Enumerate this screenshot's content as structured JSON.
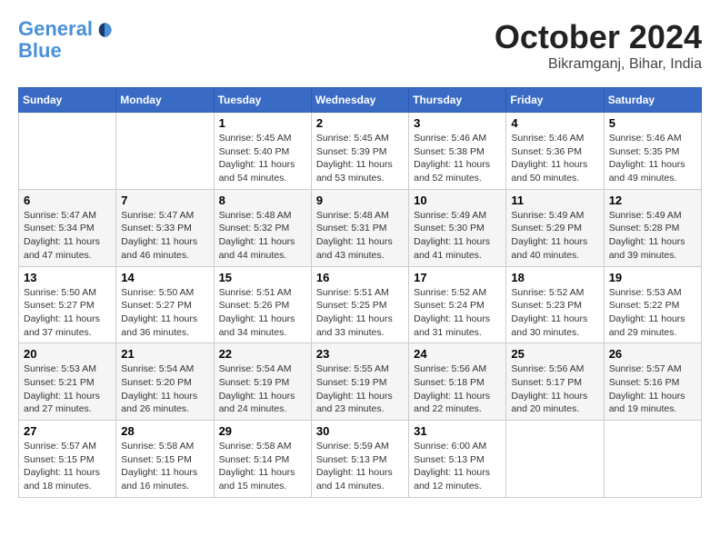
{
  "header": {
    "logo": {
      "line1": "General",
      "line2": "Blue"
    },
    "title": "October 2024",
    "location": "Bikramganj, Bihar, India"
  },
  "weekdays": [
    "Sunday",
    "Monday",
    "Tuesday",
    "Wednesday",
    "Thursday",
    "Friday",
    "Saturday"
  ],
  "weeks": [
    [
      {
        "day": null,
        "text": ""
      },
      {
        "day": null,
        "text": ""
      },
      {
        "day": "1",
        "text": "Sunrise: 5:45 AM\nSunset: 5:40 PM\nDaylight: 11 hours and 54 minutes."
      },
      {
        "day": "2",
        "text": "Sunrise: 5:45 AM\nSunset: 5:39 PM\nDaylight: 11 hours and 53 minutes."
      },
      {
        "day": "3",
        "text": "Sunrise: 5:46 AM\nSunset: 5:38 PM\nDaylight: 11 hours and 52 minutes."
      },
      {
        "day": "4",
        "text": "Sunrise: 5:46 AM\nSunset: 5:36 PM\nDaylight: 11 hours and 50 minutes."
      },
      {
        "day": "5",
        "text": "Sunrise: 5:46 AM\nSunset: 5:35 PM\nDaylight: 11 hours and 49 minutes."
      }
    ],
    [
      {
        "day": "6",
        "text": "Sunrise: 5:47 AM\nSunset: 5:34 PM\nDaylight: 11 hours and 47 minutes."
      },
      {
        "day": "7",
        "text": "Sunrise: 5:47 AM\nSunset: 5:33 PM\nDaylight: 11 hours and 46 minutes."
      },
      {
        "day": "8",
        "text": "Sunrise: 5:48 AM\nSunset: 5:32 PM\nDaylight: 11 hours and 44 minutes."
      },
      {
        "day": "9",
        "text": "Sunrise: 5:48 AM\nSunset: 5:31 PM\nDaylight: 11 hours and 43 minutes."
      },
      {
        "day": "10",
        "text": "Sunrise: 5:49 AM\nSunset: 5:30 PM\nDaylight: 11 hours and 41 minutes."
      },
      {
        "day": "11",
        "text": "Sunrise: 5:49 AM\nSunset: 5:29 PM\nDaylight: 11 hours and 40 minutes."
      },
      {
        "day": "12",
        "text": "Sunrise: 5:49 AM\nSunset: 5:28 PM\nDaylight: 11 hours and 39 minutes."
      }
    ],
    [
      {
        "day": "13",
        "text": "Sunrise: 5:50 AM\nSunset: 5:27 PM\nDaylight: 11 hours and 37 minutes."
      },
      {
        "day": "14",
        "text": "Sunrise: 5:50 AM\nSunset: 5:27 PM\nDaylight: 11 hours and 36 minutes."
      },
      {
        "day": "15",
        "text": "Sunrise: 5:51 AM\nSunset: 5:26 PM\nDaylight: 11 hours and 34 minutes."
      },
      {
        "day": "16",
        "text": "Sunrise: 5:51 AM\nSunset: 5:25 PM\nDaylight: 11 hours and 33 minutes."
      },
      {
        "day": "17",
        "text": "Sunrise: 5:52 AM\nSunset: 5:24 PM\nDaylight: 11 hours and 31 minutes."
      },
      {
        "day": "18",
        "text": "Sunrise: 5:52 AM\nSunset: 5:23 PM\nDaylight: 11 hours and 30 minutes."
      },
      {
        "day": "19",
        "text": "Sunrise: 5:53 AM\nSunset: 5:22 PM\nDaylight: 11 hours and 29 minutes."
      }
    ],
    [
      {
        "day": "20",
        "text": "Sunrise: 5:53 AM\nSunset: 5:21 PM\nDaylight: 11 hours and 27 minutes."
      },
      {
        "day": "21",
        "text": "Sunrise: 5:54 AM\nSunset: 5:20 PM\nDaylight: 11 hours and 26 minutes."
      },
      {
        "day": "22",
        "text": "Sunrise: 5:54 AM\nSunset: 5:19 PM\nDaylight: 11 hours and 24 minutes."
      },
      {
        "day": "23",
        "text": "Sunrise: 5:55 AM\nSunset: 5:19 PM\nDaylight: 11 hours and 23 minutes."
      },
      {
        "day": "24",
        "text": "Sunrise: 5:56 AM\nSunset: 5:18 PM\nDaylight: 11 hours and 22 minutes."
      },
      {
        "day": "25",
        "text": "Sunrise: 5:56 AM\nSunset: 5:17 PM\nDaylight: 11 hours and 20 minutes."
      },
      {
        "day": "26",
        "text": "Sunrise: 5:57 AM\nSunset: 5:16 PM\nDaylight: 11 hours and 19 minutes."
      }
    ],
    [
      {
        "day": "27",
        "text": "Sunrise: 5:57 AM\nSunset: 5:15 PM\nDaylight: 11 hours and 18 minutes."
      },
      {
        "day": "28",
        "text": "Sunrise: 5:58 AM\nSunset: 5:15 PM\nDaylight: 11 hours and 16 minutes."
      },
      {
        "day": "29",
        "text": "Sunrise: 5:58 AM\nSunset: 5:14 PM\nDaylight: 11 hours and 15 minutes."
      },
      {
        "day": "30",
        "text": "Sunrise: 5:59 AM\nSunset: 5:13 PM\nDaylight: 11 hours and 14 minutes."
      },
      {
        "day": "31",
        "text": "Sunrise: 6:00 AM\nSunset: 5:13 PM\nDaylight: 11 hours and 12 minutes."
      },
      {
        "day": null,
        "text": ""
      },
      {
        "day": null,
        "text": ""
      }
    ]
  ]
}
